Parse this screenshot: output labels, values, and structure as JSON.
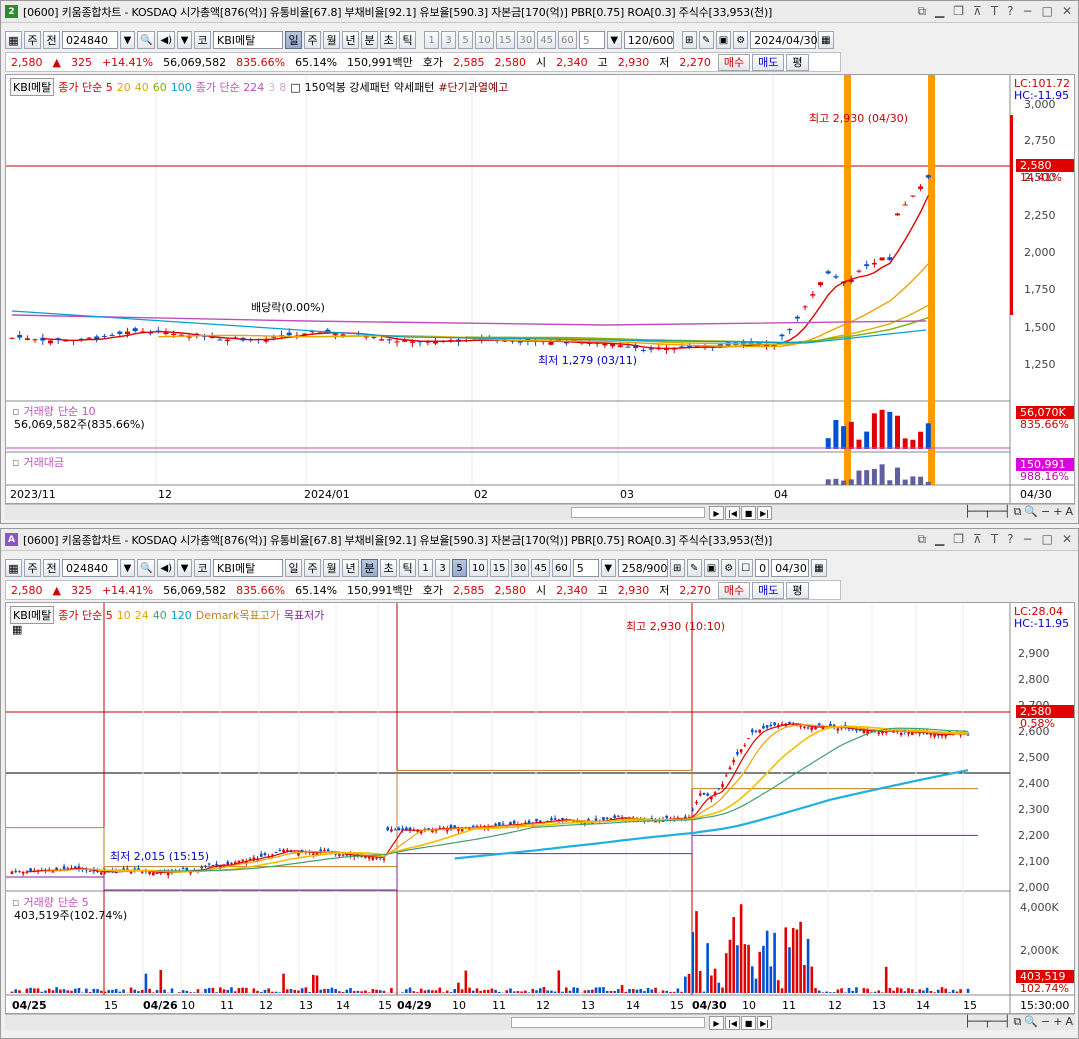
{
  "top": {
    "title_num": "2",
    "title": "[0600] 키움종합차트 - KOSDAQ 시가총액[876(억)] 유통비율[67.8] 부채비율[92.1] 유보율[590.3] 자본금[170(억)] PBR[0.75] ROA[0.3] 주식수[33,953(천)]",
    "tb": {
      "period": "주",
      "jeon": "전",
      "code": "024840",
      "kospi": "코",
      "name": "KBI메탈",
      "tabs": [
        "일",
        "주",
        "월",
        "년",
        "분",
        "초",
        "틱"
      ],
      "active_tab": "일",
      "nums": [
        "1",
        "3",
        "5",
        "10",
        "15",
        "30",
        "45",
        "60"
      ],
      "sel": "5",
      "count": "120/600",
      "date": "2024/04/30"
    },
    "quote": {
      "price": "2,580",
      "change": "325",
      "rate": "+14.41%",
      "vol": "56,069,582",
      "volrate": "835.66%",
      "rate2": "65.14%",
      "amount": "150,991백만",
      "hoga_l": "호가",
      "hoga1": "2,585",
      "hoga2": "2,580",
      "open_l": "시",
      "open": "2,340",
      "high_l": "고",
      "high": "2,930",
      "low_l": "저",
      "low": "2,270",
      "buy": "매수",
      "sell": "매도",
      "pyeong": "평"
    },
    "legend": {
      "tag": "KBI메탈",
      "a": "종가 단순 5",
      "b": "20",
      "c": "40",
      "d": "60",
      "e": "100",
      "f": "종가 단순 224",
      "g": "3",
      "h": "8",
      "i": "150억봉 강세패턴",
      "j": "약세패턴",
      "k": "#단기과열예고"
    },
    "right": {
      "lc": "LC:101.72",
      "hc": "HC:-11.95",
      "y": [
        "3,000",
        "2,750",
        "2,500",
        "2,250",
        "2,000",
        "1,750",
        "1,500",
        "1,250"
      ],
      "price": "2,580",
      "pct": "14.41%"
    },
    "notes": {
      "max": "최고 2,930 (04/30)",
      "min": "최저 1,279 (03/11)",
      "div": "배당락(0.00%)"
    },
    "vol": {
      "title": "거래량",
      "sub": "단순 10",
      "val": "56,069,582주(835.66%)",
      "r1": "56,070K",
      "r2": "835.66%"
    },
    "amt": {
      "title": "거래대금",
      "r1": "150,991",
      "r2": "988.16%"
    },
    "x": [
      "2023/11",
      "12",
      "2024/01",
      "02",
      "03",
      "04"
    ],
    "xlast": "04/30"
  },
  "bot": {
    "title_num": "A",
    "title": "[0600] 키움종합차트 - KOSDAQ 시가총액[876(억)] 유통비율[67.8] 부채비율[92.1] 유보율[590.3] 자본금[170(억)] PBR[0.75] ROA[0.3] 주식수[33,953(천)]",
    "tb": {
      "period": "주",
      "jeon": "전",
      "code": "024840",
      "kospi": "코",
      "name": "KBI메탈",
      "tabs": [
        "일",
        "주",
        "월",
        "년",
        "분",
        "초",
        "틱"
      ],
      "active_tab": "분",
      "nums": [
        "1",
        "3",
        "5",
        "10",
        "15",
        "30",
        "45",
        "60"
      ],
      "active_num": "5",
      "sel": "5",
      "count": "258/900",
      "zero": "0",
      "date": "04/30"
    },
    "quote": {
      "price": "2,580",
      "change": "325",
      "rate": "+14.41%",
      "vol": "56,069,582",
      "volrate": "835.66%",
      "rate2": "65.14%",
      "amount": "150,991백만",
      "hoga_l": "호가",
      "hoga1": "2,585",
      "hoga2": "2,580",
      "open_l": "시",
      "open": "2,340",
      "high_l": "고",
      "high": "2,930",
      "low_l": "저",
      "low": "2,270",
      "buy": "매수",
      "sell": "매도",
      "pyeong": "평"
    },
    "legend": {
      "tag": "KBI메탈",
      "a": "종가 단순 5",
      "b": "10",
      "c": "24",
      "d": "40",
      "e": "120",
      "f": "Demark목표고가",
      "g": "목표저가"
    },
    "right": {
      "lc": "LC:28.04",
      "hc": "HC:-11.95",
      "y": [
        "2,900",
        "2,800",
        "2,700",
        "2,600",
        "2,500",
        "2,400",
        "2,300",
        "2,200",
        "2,100",
        "2,000"
      ],
      "price": "2,580",
      "pct": "0.58%"
    },
    "notes": {
      "max": "최고 2,930 (10:10)",
      "min": "최저 2,015 (15:15)"
    },
    "vol": {
      "title": "거래량",
      "sub": "단순 5",
      "val": "403,519주(102.74%)",
      "y1": "4,000K",
      "y2": "2,000K",
      "r1": "403,519",
      "r2": "102.74%"
    },
    "x": [
      "04/25",
      "15",
      "04/26",
      "10",
      "11",
      "12",
      "13",
      "14",
      "15",
      "04/29",
      "10",
      "11",
      "12",
      "13",
      "14",
      "15",
      "04/30",
      "10",
      "11",
      "12",
      "13",
      "14",
      "15"
    ],
    "xlast": "15:30:00"
  }
}
